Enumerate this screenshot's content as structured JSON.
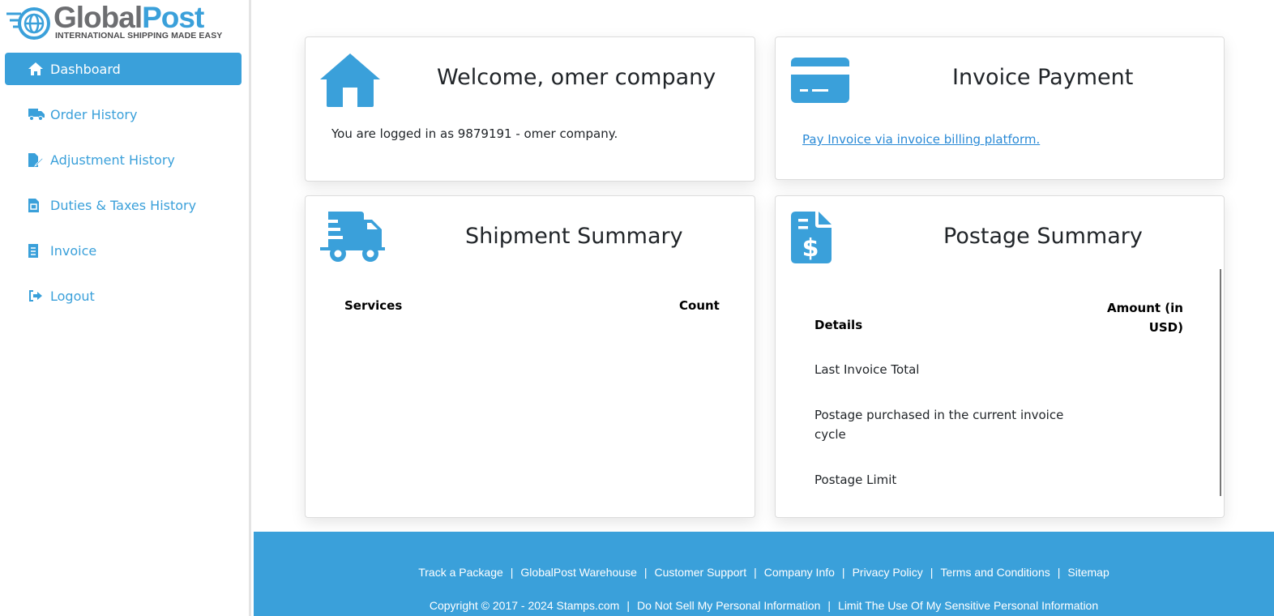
{
  "logo": {
    "brand_part1": "Global",
    "brand_part2": "Post",
    "tagline": "INTERNATIONAL SHIPPING MADE EASY"
  },
  "sidebar": {
    "items": [
      {
        "label": "Dashboard",
        "icon": "home-icon",
        "active": true
      },
      {
        "label": "Order History",
        "icon": "truck-icon"
      },
      {
        "label": "Adjustment History",
        "icon": "file-edit-icon"
      },
      {
        "label": "Duties & Taxes History",
        "icon": "file-invoice-icon"
      },
      {
        "label": "Invoice",
        "icon": "receipt-icon"
      },
      {
        "label": "Logout",
        "icon": "sign-out-icon"
      }
    ]
  },
  "welcome": {
    "title": "Welcome, omer company",
    "text": "You are logged in as 9879191 - omer company."
  },
  "invoice_payment": {
    "title": "Invoice Payment",
    "link": "Pay Invoice via invoice billing platform."
  },
  "shipment_summary": {
    "title": "Shipment Summary",
    "col_services": "Services",
    "col_count": "Count"
  },
  "postage_summary": {
    "title": "Postage Summary",
    "col_details": "Details",
    "col_amount_line1": "Amount (in",
    "col_amount_line2": "USD)",
    "rows": [
      {
        "label": "Last Invoice Total"
      },
      {
        "label_line1": "Postage purchased in the current invoice",
        "label_line2": "cycle"
      },
      {
        "label": "Postage Limit"
      }
    ]
  },
  "footer": {
    "links_row1": [
      "Track a Package",
      "GlobalPost Warehouse",
      "Customer Support",
      "Company Info",
      "Privacy Policy",
      "Terms and Conditions",
      "Sitemap"
    ],
    "row2": [
      "Copyright © 2017 - 2024 Stamps.com",
      "Do Not Sell My Personal Information",
      "Limit The Use Of My Sensitive Personal Information"
    ],
    "separator": "|"
  },
  "colors": {
    "accent": "#3aa0da",
    "link": "#2a8ad6",
    "logo_gray": "#6d6e71"
  }
}
